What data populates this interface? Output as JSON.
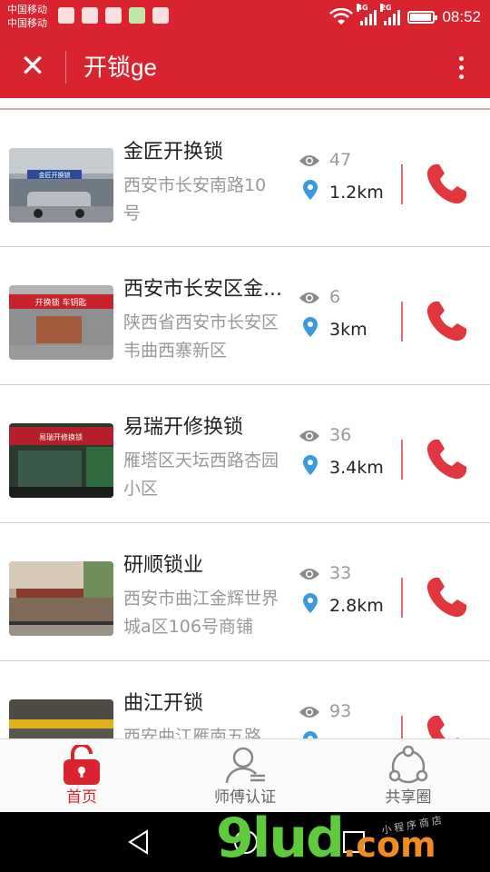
{
  "status_bar": {
    "carrier_1": "中国移动",
    "carrier_2": "中国移动",
    "network_1": "4G",
    "network_2": "2G",
    "time": "08:52",
    "notification_icons": [
      "baidu-icon",
      "app-icon",
      "map-icon",
      "wechat-icon",
      "gallery-icon"
    ]
  },
  "header": {
    "close_label": "✕",
    "title": "开锁ge"
  },
  "shops": [
    {
      "name": "金匠开换锁",
      "address": "西安市长安南路10号",
      "views": "47",
      "distance": "1.2km",
      "thumb_sign": "金匠开换锁"
    },
    {
      "name": "西安市长安区金...",
      "address": "陕西省西安市长安区韦曲西寨新区",
      "views": "6",
      "distance": "3km",
      "thumb_sign": "开换锁 车钥匙"
    },
    {
      "name": "易瑞开修换锁",
      "address": "雁塔区天坛西路杏园小区",
      "views": "36",
      "distance": "3.4km",
      "thumb_sign": "易瑞开修换锁"
    },
    {
      "name": "研顺锁业",
      "address": "西安市曲江金辉世界城a区106号商铺",
      "views": "33",
      "distance": "2.8km",
      "thumb_sign": ""
    },
    {
      "name": "曲江开锁",
      "address": "西安曲江雁南五路",
      "views": "93",
      "distance": "",
      "thumb_sign": ""
    }
  ],
  "tabs": [
    {
      "label": "首页",
      "icon": "lock-home-icon",
      "active": true
    },
    {
      "label": "师傅认证",
      "icon": "user-verify-icon",
      "active": false
    },
    {
      "label": "共享圈",
      "icon": "share-circle-icon",
      "active": false
    }
  ],
  "watermark": {
    "main": "9lud",
    "suffix": ".com",
    "sub": "小程序商店"
  },
  "colors": {
    "brand_red": "#d9232e",
    "call_red": "#e2363f",
    "pin_blue": "#3a9ae0",
    "muted_text": "#999999"
  }
}
